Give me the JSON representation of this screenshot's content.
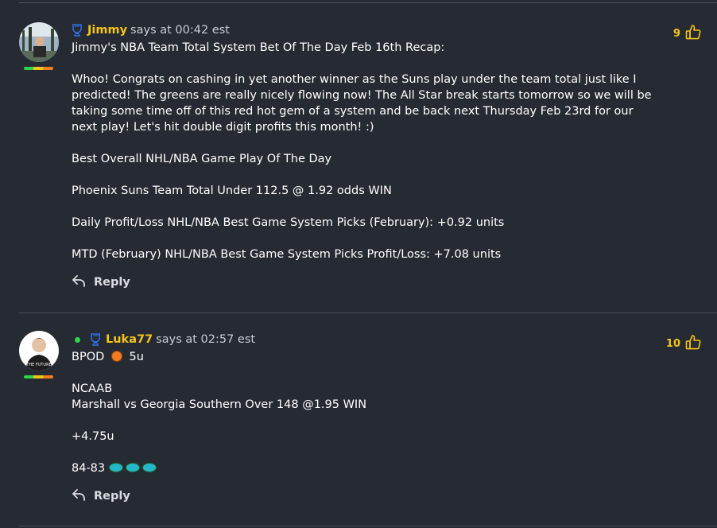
{
  "comments": [
    {
      "username": "Jimmy",
      "says": "says at 00:42 est",
      "likes": "9",
      "paragraphs": [
        "Jimmy's NBA Team Total System Bet Of The Day Feb 16th Recap:",
        "",
        "Whoo! Congrats on cashing in yet another winner as the Suns play under the team total just like I predicted! The greens are really nicely flowing now! The All Star break starts tomorrow so we will be taking some time off of this red hot gem of a system and be back next Thursday Feb 23rd for our next play! Let's hit double digit profits this month! :)",
        "",
        "Best Overall NHL/NBA Game Play Of The Day",
        "",
        "Phoenix Suns Team Total Under 112.5 @ 1.92 odds WIN",
        "",
        "Daily Profit/Loss NHL/NBA Best Game System Picks (February): +0.92 units",
        "",
        "MTD (February) NHL/NBA Best Game System Picks Profit/Loss: +7.08 units"
      ],
      "reply_label": "Reply"
    },
    {
      "username": "Luka77",
      "says": "says at 02:57 est",
      "likes": "10",
      "online": true,
      "avatar_text": "THE FUTURE",
      "first_line_a": "BPOD",
      "first_line_b": "5u",
      "paragraphs": [
        "",
        "NCAAB",
        "Marshall vs Georgia Southern Over 148 @1.95 WIN",
        "",
        "+4.75u",
        ""
      ],
      "record": "84-83",
      "reply_label": "Reply"
    }
  ],
  "colors": {
    "accent": "#f5c518",
    "background": "#262a33",
    "online": "#2bd44b",
    "badge": "#2f6fe0"
  }
}
